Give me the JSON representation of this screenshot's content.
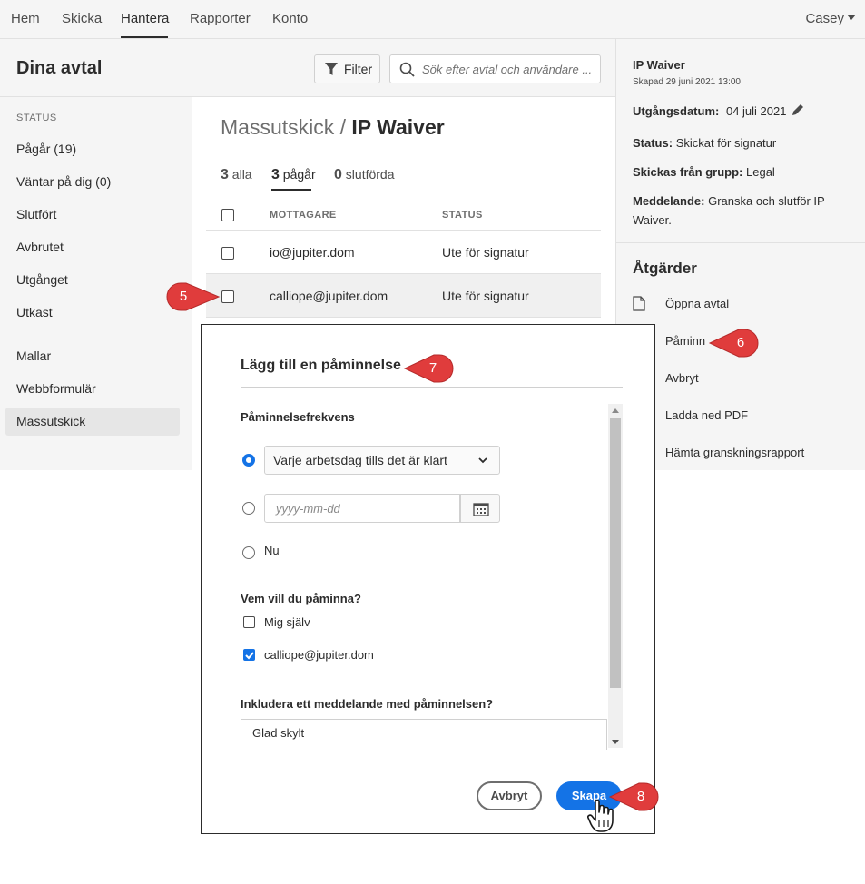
{
  "nav": {
    "items": [
      "Hem",
      "Skicka",
      "Hantera",
      "Rapporter",
      "Konto"
    ],
    "active": "Hantera",
    "user": "Casey"
  },
  "header": {
    "title": "Dina avtal",
    "filter_label": "Filter",
    "search_placeholder": "Sök efter avtal och användare ..."
  },
  "sidebar": {
    "status_heading": "STATUS",
    "status_items": [
      "Pågår (19)",
      "Väntar på dig (0)",
      "Slutfört",
      "Avbrutet",
      "Utgånget",
      "Utkast"
    ],
    "other_items": [
      "Mallar",
      "Webbformulär",
      "Massutskick"
    ],
    "active": "Massutskick"
  },
  "main": {
    "breadcrumb_parent": "Massutskick",
    "breadcrumb_sep": " / ",
    "breadcrumb_current": "IP Waiver",
    "tabs": [
      {
        "count": "3",
        "label": "alla"
      },
      {
        "count": "3",
        "label": "pågår"
      },
      {
        "count": "0",
        "label": "slutförda"
      }
    ],
    "columns": [
      "MOTTAGARE",
      "STATUS"
    ],
    "rows": [
      {
        "recipient": "io@jupiter.dom",
        "status": "Ute för signatur"
      },
      {
        "recipient": "calliope@jupiter.dom",
        "status": "Ute för signatur"
      }
    ]
  },
  "details": {
    "title": "IP Waiver",
    "created": "Skapad 29 juni 2021 13:00",
    "expiry_label": "Utgångsdatum:",
    "expiry_value": "04 juli 2021",
    "status_label": "Status:",
    "status_value": "Skickat för signatur",
    "group_label": "Skickas från grupp:",
    "group_value": "Legal",
    "message_label": "Meddelande:",
    "message_value": "Granska och slutför IP Waiver.",
    "actions_heading": "Åtgärder",
    "actions": [
      "Öppna avtal",
      "Påminn",
      "Avbryt",
      "Ladda ned PDF",
      "Hämta granskningsrapport"
    ]
  },
  "modal": {
    "title": "Lägg till en påminnelse",
    "frequency_label": "Påminnelsefrekvens",
    "frequency_selected": "Varje arbetsdag tills det är klart",
    "date_placeholder": "yyyy-mm-dd",
    "now_label": "Nu",
    "who_label": "Vem vill du påminna?",
    "who_options": [
      {
        "label": "Mig själv",
        "checked": false
      },
      {
        "label": "calliope@jupiter.dom",
        "checked": true
      }
    ],
    "message_label": "Inkludera ett meddelande med påminnelsen?",
    "message_value": "Glad skylt",
    "cancel_label": "Avbryt",
    "create_label": "Skapa"
  },
  "callouts": [
    "5",
    "6",
    "7",
    "8"
  ],
  "colors": {
    "accent": "#1473e6",
    "callout": "#e03c3c",
    "panel_bg": "#f5f5f5"
  }
}
